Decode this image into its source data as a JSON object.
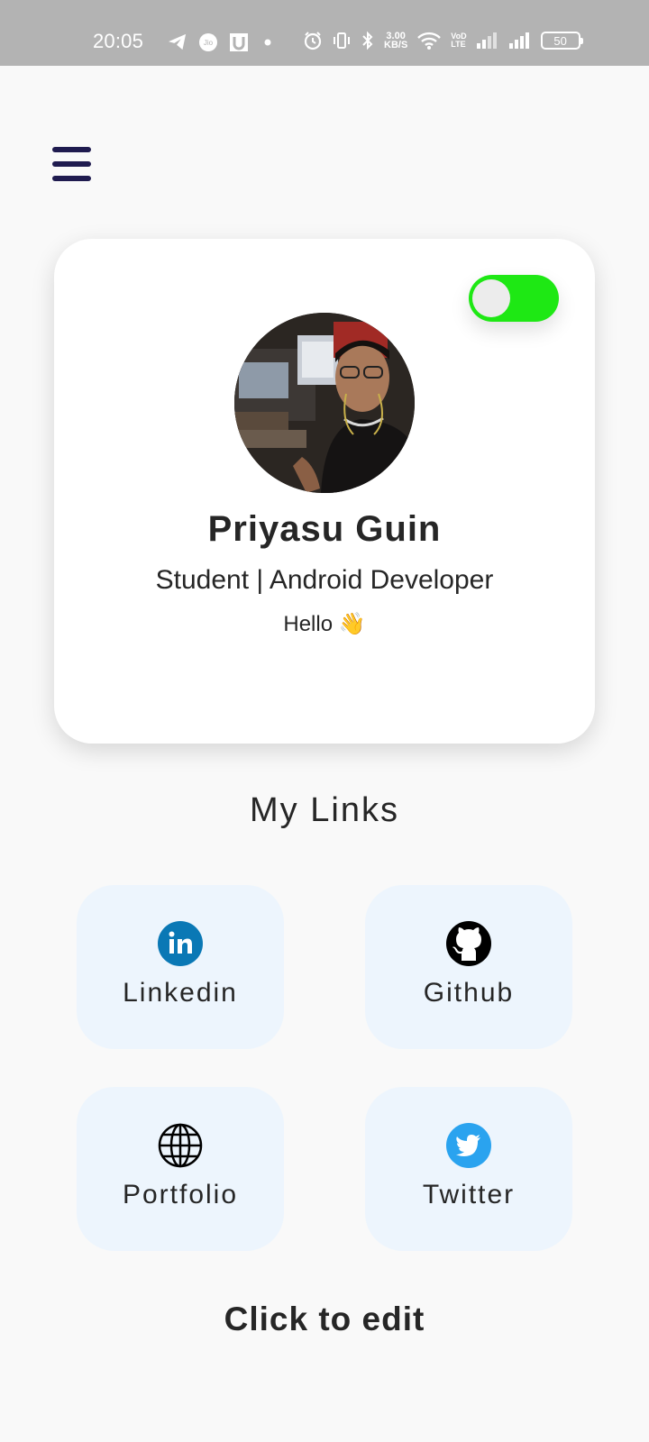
{
  "status_bar": {
    "time": "20:05",
    "net_speed_value": "3.00",
    "net_speed_unit": "KB/S",
    "volte_top": "VoD",
    "volte_bottom": "LTE",
    "battery": "50",
    "icons": [
      "telegram-icon",
      "jio-icon",
      "u-icon",
      "dot-icon",
      "alarm-icon",
      "vibrate-icon",
      "bluetooth-icon",
      "wifi-icon",
      "signal-icon",
      "signal-icon",
      "battery-icon"
    ]
  },
  "profile": {
    "name": "Priyasu Guin",
    "title": "Student | Android Developer",
    "bio": "Hello 👋",
    "toggle_on": true,
    "toggle_color": "#1ee814"
  },
  "links": {
    "heading": "My Links",
    "items": [
      {
        "label": "Linkedin",
        "icon": "linkedin-icon",
        "color": "#0a78b5"
      },
      {
        "label": "Github",
        "icon": "github-icon",
        "color": "#000000"
      },
      {
        "label": "Portfolio",
        "icon": "globe-icon",
        "color": "#000000"
      },
      {
        "label": "Twitter",
        "icon": "twitter-icon",
        "color": "#2aa3ef"
      }
    ]
  },
  "footer": {
    "edit_label": "Click to edit"
  },
  "colors": {
    "background": "#f9f9f9",
    "tile_background": "#edf5fd",
    "menu_icon": "#1f1b4f",
    "status_bar": "#b3b3b3"
  }
}
